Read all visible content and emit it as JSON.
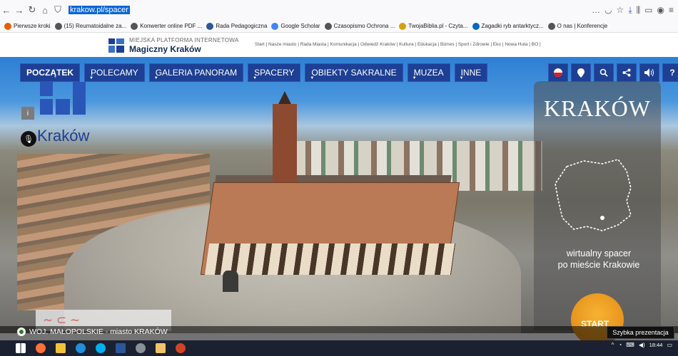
{
  "browser": {
    "url": "krakow.pl/spacer"
  },
  "bookmarks": [
    {
      "label": "Pierwsze kroki",
      "color": "#e66000"
    },
    {
      "label": "(15) Reumatoidalne za...",
      "color": "#555555"
    },
    {
      "label": "Konwerter online PDF ...",
      "color": "#555555"
    },
    {
      "label": "Rada Pedagogiczna",
      "color": "#2b5797"
    },
    {
      "label": "Google Scholar",
      "color": "#4285f4"
    },
    {
      "label": "Czasopismo Ochrona ...",
      "color": "#555555"
    },
    {
      "label": "TwojaBiblia.pl - Czyta...",
      "color": "#d4a017"
    },
    {
      "label": "Zagadki ryb antarktycz...",
      "color": "#0a66c2"
    },
    {
      "label": "O nas | Konferencje",
      "color": "#555555"
    }
  ],
  "site": {
    "logo_sub": "MIEJSKA PLATFORMA INTERNETOWA",
    "logo_main": "Magiczny Kraków",
    "top_links": "Start | Nasze miasto | Rada Miasta | Komunikacja | Odwiedź Kraków | Kultura | Edukacja | Biznes | Sport i Zdrowie | Eko | Nowa Huta | BO |"
  },
  "menu": [
    {
      "label": "POCZĄTEK"
    },
    {
      "label": "POLECAMY"
    },
    {
      "label": "GALERIA PANORAM"
    },
    {
      "label": "SPACERY"
    },
    {
      "label": "OBIEKTY SAKRALNE"
    },
    {
      "label": "MUZEA"
    },
    {
      "label": "INNE"
    }
  ],
  "tools": [
    {
      "name": "flag-icon",
      "glyph": ""
    },
    {
      "name": "location-pin-icon",
      "glyph": "●"
    },
    {
      "name": "search-icon",
      "glyph": "🔍"
    },
    {
      "name": "share-icon",
      "glyph": "<"
    },
    {
      "name": "volume-icon",
      "glyph": "◀)"
    },
    {
      "name": "help-icon",
      "glyph": "?"
    }
  ],
  "overlay": {
    "info_glyph": "i",
    "krakow_word": "Kraków",
    "panel_title": "KRAKÓW",
    "panel_text_1": "wirtualny spacer",
    "panel_text_2": "po mieście Krakowie",
    "start_label": "START",
    "region_label": "WOJ. MAŁOPOLSKIE - miasto KRAKÓW",
    "quick_label": "Szybka prezentacja"
  },
  "taskbar": {
    "time": "18:44"
  }
}
